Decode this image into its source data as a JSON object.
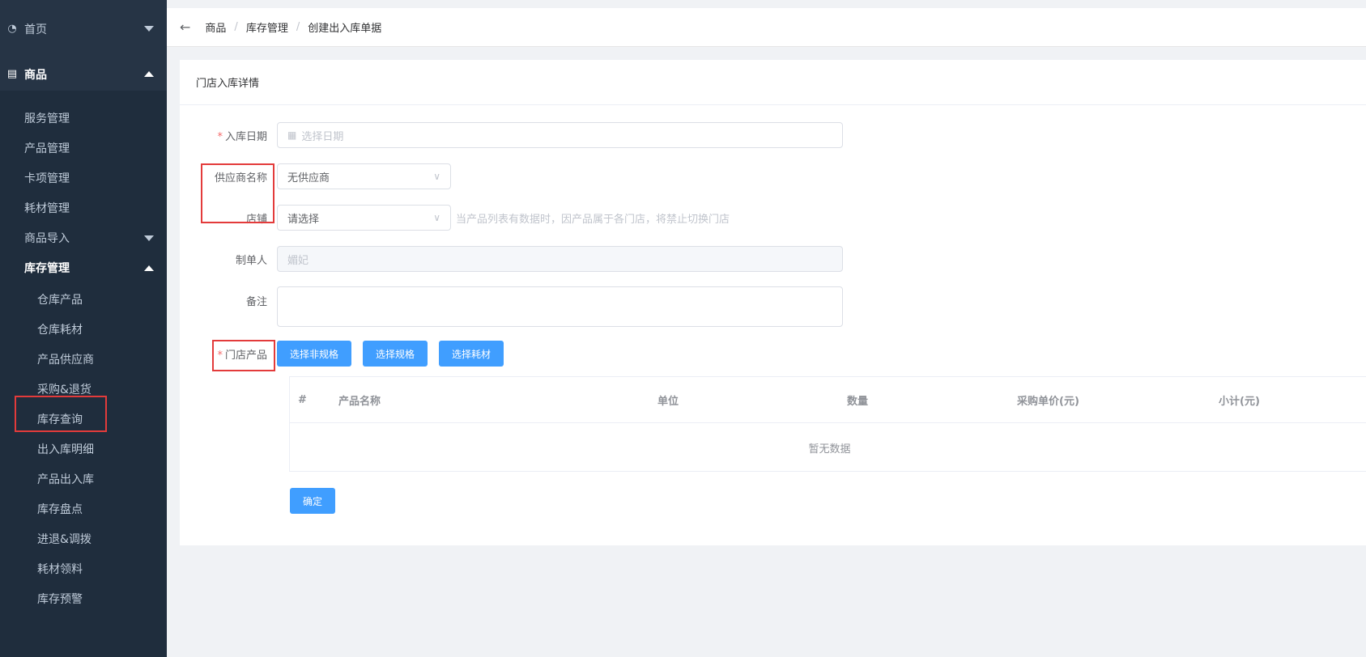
{
  "sidebar": {
    "top_items": [
      {
        "label": "首页",
        "icon": "dashboard-icon"
      },
      {
        "label": "商品",
        "icon": "document-icon"
      }
    ],
    "goods_children": [
      "服务管理",
      "产品管理",
      "卡项管理",
      "耗材管理",
      "商品导入",
      "库存管理"
    ],
    "inventory_children": [
      "仓库产品",
      "仓库耗材",
      "产品供应商",
      "采购&退货",
      "库存查询",
      "出入库明细",
      "产品出入库",
      "库存盘点",
      "进退&调拨",
      "耗材领料",
      "库存预警"
    ]
  },
  "breadcrumb": {
    "items": [
      "商品",
      "库存管理",
      "创建出入库单据"
    ],
    "separator": "/"
  },
  "card": {
    "title": "门店入库详情"
  },
  "form": {
    "date": {
      "label": "入库日期",
      "placeholder": "选择日期"
    },
    "supplier": {
      "label": "供应商名称",
      "value": "无供应商"
    },
    "store": {
      "label": "店铺",
      "placeholder": "请选择",
      "hint": "当产品列表有数据时，因产品属于各门店，将禁止切换门店"
    },
    "creator": {
      "label": "制单人",
      "value": "媚妃"
    },
    "remark": {
      "label": "备注"
    },
    "products": {
      "label": "门店产品"
    },
    "buttons": {
      "non_spec": "选择非规格",
      "spec": "选择规格",
      "consumable": "选择耗材"
    },
    "submit": "确定"
  },
  "table": {
    "columns": [
      "#",
      "产品名称",
      "单位",
      "数量",
      "采购单价(元)",
      "小计(元)"
    ],
    "empty_text": "暂无数据"
  },
  "colors": {
    "sidebar_bg": "#1f2d3d",
    "primary": "#409eff",
    "highlight_border": "#e33b3b",
    "required": "#f56c6c"
  }
}
